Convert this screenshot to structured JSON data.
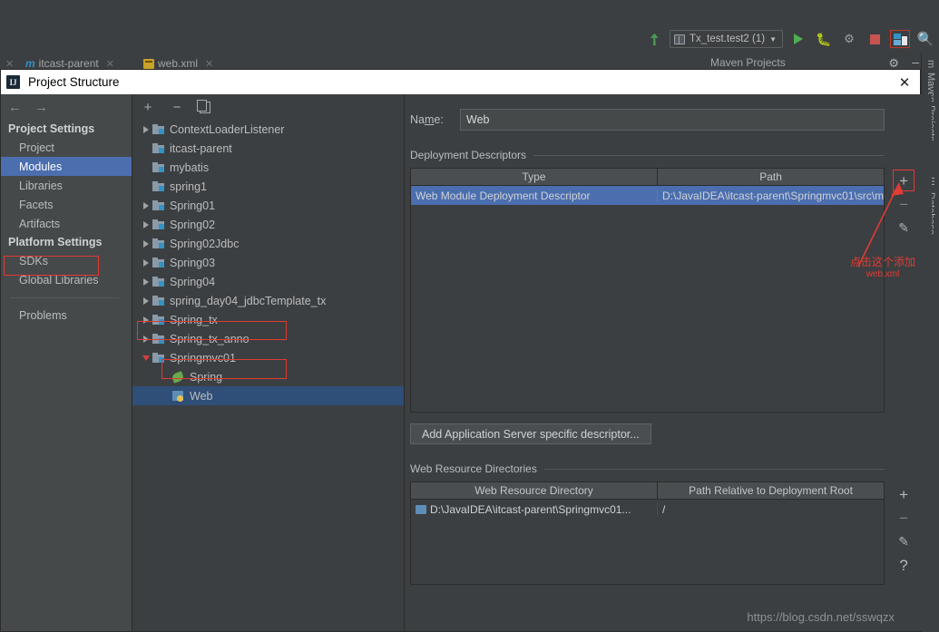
{
  "ide": {
    "toolbar": {
      "back_arrow_icon": "arrow-back-green",
      "run_config_label": "Tx_test.test2 (1)",
      "run_icon": "run-play-icon",
      "debug_icon": "debug-bug-icon",
      "rerun_icon": "rerun-icon",
      "stop_icon": "stop-icon",
      "project_structure_icon": "project-structure-icon",
      "search_icon": "search-icon"
    },
    "editor_tabs": [
      {
        "label": "itcast-parent",
        "icon": "maven-m-icon"
      },
      {
        "label": "web.xml",
        "icon": "xml-file-icon"
      }
    ],
    "maven_panel": {
      "title": "Maven Projects",
      "settings_icon": "gear-icon",
      "minimize_icon": "minimize-icon"
    },
    "vertical_tabs": [
      {
        "label": "Maven Projects",
        "icon": "maven-m-icon"
      },
      {
        "label": "Database",
        "icon": "database-icon"
      }
    ]
  },
  "dialog": {
    "title": "Project Structure",
    "app_icon": "intellij-idea-icon",
    "close_label": "✕",
    "nav": {
      "back_icon": "arrow-left-icon",
      "forward_icon": "arrow-right-icon"
    },
    "settings": {
      "groups": [
        {
          "title": "Project Settings",
          "items": [
            {
              "label": "Project",
              "selected": false
            },
            {
              "label": "Modules",
              "selected": true
            },
            {
              "label": "Libraries",
              "selected": false
            },
            {
              "label": "Facets",
              "selected": false
            },
            {
              "label": "Artifacts",
              "selected": false
            }
          ]
        },
        {
          "title": "Platform Settings",
          "items": [
            {
              "label": "SDKs",
              "selected": false
            },
            {
              "label": "Global Libraries",
              "selected": false
            }
          ]
        }
      ],
      "problems_label": "Problems"
    },
    "tree_toolbar": {
      "add_label": "+",
      "remove_label": "−",
      "copy_icon": "copy-icon"
    },
    "modules_tree": [
      {
        "label": "ContextLoaderListener",
        "expander": "collapsed",
        "icon": "module-icon",
        "depth": 0,
        "selected": false
      },
      {
        "label": "itcast-parent",
        "expander": "none",
        "icon": "module-icon",
        "depth": 0,
        "selected": false
      },
      {
        "label": "mybatis",
        "expander": "none",
        "icon": "module-icon",
        "depth": 0,
        "selected": false
      },
      {
        "label": "spring1",
        "expander": "none",
        "icon": "module-icon",
        "depth": 0,
        "selected": false
      },
      {
        "label": "Spring01",
        "expander": "collapsed",
        "icon": "module-icon",
        "depth": 0,
        "selected": false
      },
      {
        "label": "Spring02",
        "expander": "collapsed",
        "icon": "module-icon",
        "depth": 0,
        "selected": false
      },
      {
        "label": "Spring02Jdbc",
        "expander": "collapsed",
        "icon": "module-icon",
        "depth": 0,
        "selected": false
      },
      {
        "label": "Spring03",
        "expander": "collapsed",
        "icon": "module-icon",
        "depth": 0,
        "selected": false
      },
      {
        "label": "Spring04",
        "expander": "collapsed",
        "icon": "module-icon",
        "depth": 0,
        "selected": false
      },
      {
        "label": "spring_day04_jdbcTemplate_tx",
        "expander": "collapsed",
        "icon": "module-icon",
        "depth": 0,
        "selected": false
      },
      {
        "label": "Spring_tx",
        "expander": "collapsed",
        "icon": "module-icon",
        "depth": 0,
        "selected": false
      },
      {
        "label": "Spring_tx_anno",
        "expander": "collapsed",
        "icon": "module-icon",
        "depth": 0,
        "selected": false
      },
      {
        "label": "Springmvc01",
        "expander": "expanded",
        "icon": "module-icon",
        "depth": 0,
        "selected": false
      },
      {
        "label": "Spring",
        "expander": "none",
        "icon": "spring-facet-icon",
        "depth": 1,
        "selected": false
      },
      {
        "label": "Web",
        "expander": "none",
        "icon": "web-facet-icon",
        "depth": 1,
        "selected": true
      }
    ],
    "facet": {
      "name_label": "Name:",
      "name_value": "Web",
      "deployment_descriptors": {
        "section_title": "Deployment Descriptors",
        "columns": [
          "Type",
          "Path"
        ],
        "rows": [
          {
            "type": "Web Module Deployment Descriptor",
            "path": "D:\\JavaIDEA\\itcast-parent\\Springmvc01\\src\\m",
            "selected": true
          }
        ],
        "buttons": {
          "add": "+",
          "remove": "−",
          "edit_icon": "pencil-icon"
        }
      },
      "add_app_server_button": "Add Application Server specific descriptor...",
      "web_resource_directories": {
        "section_title": "Web Resource Directories",
        "columns": [
          "Web Resource Directory",
          "Path Relative to Deployment Root"
        ],
        "rows": [
          {
            "directory": "D:\\JavaIDEA\\itcast-parent\\Springmvc01...",
            "relative_path": "/",
            "icon": "folder-icon"
          }
        ],
        "buttons": {
          "add": "+",
          "remove": "−",
          "edit_icon": "pencil-icon",
          "help": "?"
        }
      }
    },
    "annotation": {
      "line1": "点击这个添加",
      "line2": "web.xml",
      "color": "#e03b34"
    }
  },
  "watermark": "https://blog.csdn.net/sswqzx",
  "colors": {
    "dialog_bg": "#3c3f41",
    "selection_blue": "#4b6eaf",
    "tree_selection": "#2f4e78",
    "annotation_red": "#e03b34",
    "accent_blue": "#3592c4",
    "run_green": "#4eae52",
    "stop_red": "#c75450"
  }
}
